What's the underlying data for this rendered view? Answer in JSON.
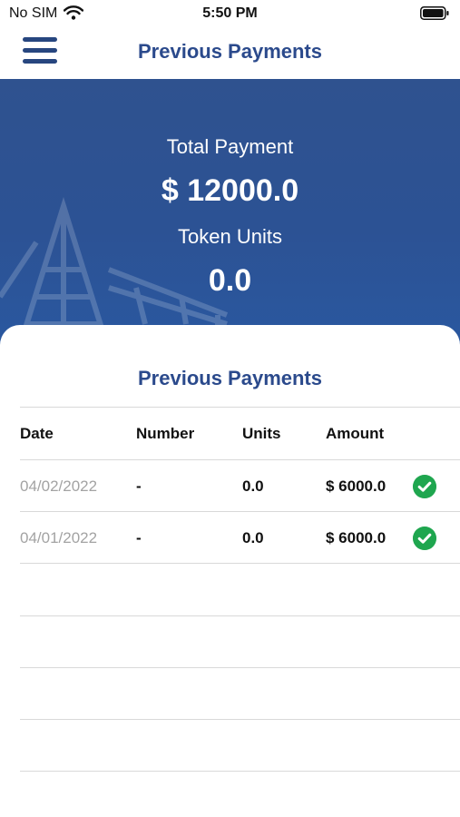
{
  "status_bar": {
    "carrier": "No SIM",
    "time": "5:50 PM"
  },
  "nav": {
    "title": "Previous Payments"
  },
  "summary": {
    "total_label": "Total Payment",
    "total_value": "$ 12000.0",
    "units_label": "Token Units",
    "units_value": "0.0"
  },
  "payments": {
    "title": "Previous  Payments",
    "columns": [
      "Date",
      "Number",
      "Units",
      "Amount"
    ],
    "rows": [
      {
        "date": "04/02/2022",
        "number": "-",
        "units": "0.0",
        "amount": "$ 6000.0",
        "status_icon": "check-circle-icon"
      },
      {
        "date": "04/01/2022",
        "number": "-",
        "units": "0.0",
        "amount": "$ 6000.0",
        "status_icon": "check-circle-icon"
      }
    ]
  },
  "colors": {
    "accent": "#2b4a8c",
    "hero": "#2c5294",
    "success": "#1fa64f"
  }
}
